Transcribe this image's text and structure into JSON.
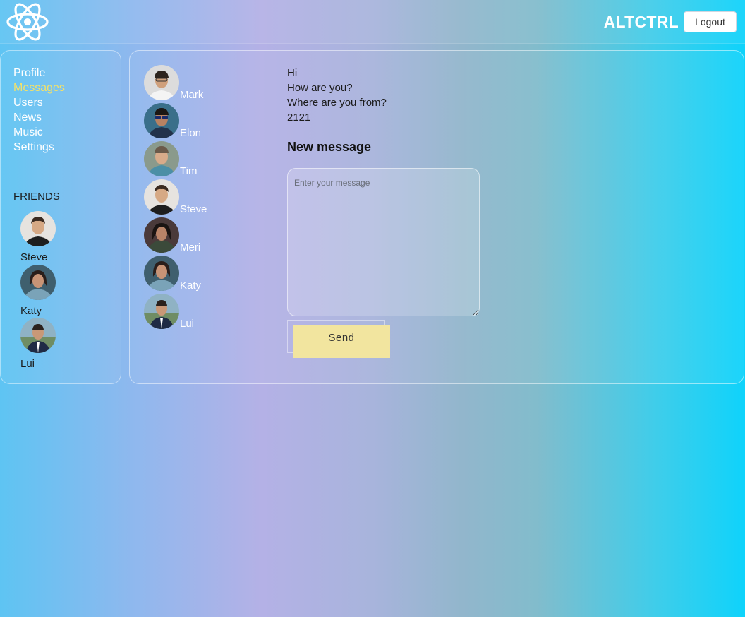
{
  "header": {
    "brand": "ALTCTRL",
    "logout_label": "Logout",
    "logo_icon": "react-atom-icon"
  },
  "nav": {
    "items": [
      {
        "label": "Profile",
        "active": false
      },
      {
        "label": "Messages",
        "active": true
      },
      {
        "label": "Users",
        "active": false
      },
      {
        "label": "News",
        "active": false
      },
      {
        "label": "Music",
        "active": false
      },
      {
        "label": "Settings",
        "active": false
      }
    ]
  },
  "friends": {
    "title": "FRIENDS",
    "items": [
      {
        "name": "Steve"
      },
      {
        "name": "Katy"
      },
      {
        "name": "Lui"
      }
    ]
  },
  "dialogs": [
    {
      "name": "Mark"
    },
    {
      "name": "Elon"
    },
    {
      "name": "Tim"
    },
    {
      "name": "Steve"
    },
    {
      "name": "Meri"
    },
    {
      "name": "Katy"
    },
    {
      "name": "Lui"
    }
  ],
  "messages": [
    {
      "text": "Hi"
    },
    {
      "text": "How are you?"
    },
    {
      "text": "Where are you from?"
    },
    {
      "text": "2121"
    }
  ],
  "composer": {
    "title": "New message",
    "placeholder": "Enter your message",
    "value": "",
    "send_label": "Send"
  },
  "colors": {
    "active_nav": "#f2e16a",
    "send_button": "#f2e59f",
    "gradient_start": "#5ec4f3",
    "gradient_mid": "#b4b1e6",
    "gradient_end": "#0fd3fb"
  }
}
